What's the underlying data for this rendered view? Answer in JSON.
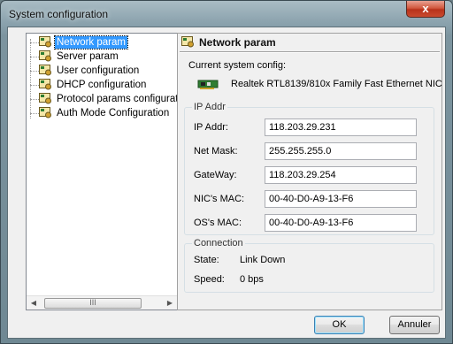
{
  "window": {
    "title": "System configuration",
    "close_symbol": "x"
  },
  "tree": {
    "items": [
      {
        "label": "Network param",
        "selected": true
      },
      {
        "label": "Server param"
      },
      {
        "label": "User configuration"
      },
      {
        "label": "DHCP configuration"
      },
      {
        "label": "Protocol params configurati"
      },
      {
        "label": "Auth Mode Configuration"
      }
    ],
    "scroll_left": "◀",
    "scroll_right": "▶",
    "scroll_grip": "III"
  },
  "panel": {
    "title": "Network param",
    "current_config_label": "Current system config:",
    "nic_name": "Realtek RTL8139/810x Family Fast Ethernet NIC",
    "ip_group": {
      "title": "IP Addr",
      "fields": [
        {
          "label": "IP Addr:",
          "value": "118.203.29.231"
        },
        {
          "label": "Net Mask:",
          "value": "255.255.255.0"
        },
        {
          "label": "GateWay:",
          "value": "118.203.29.254"
        },
        {
          "label": "NIC's MAC:",
          "value": "00-40-D0-A9-13-F6"
        },
        {
          "label": "OS's MAC:",
          "value": "00-40-D0-A9-13-F6"
        }
      ]
    },
    "connection_group": {
      "title": "Connection",
      "state_label": "State:",
      "state_value": "Link Down",
      "speed_label": "Speed:",
      "speed_value": "0 bps"
    }
  },
  "buttons": {
    "ok": "OK",
    "cancel": "Annuler"
  },
  "colors": {
    "selection": "#3399ff",
    "close_button": "#c94a2e"
  }
}
